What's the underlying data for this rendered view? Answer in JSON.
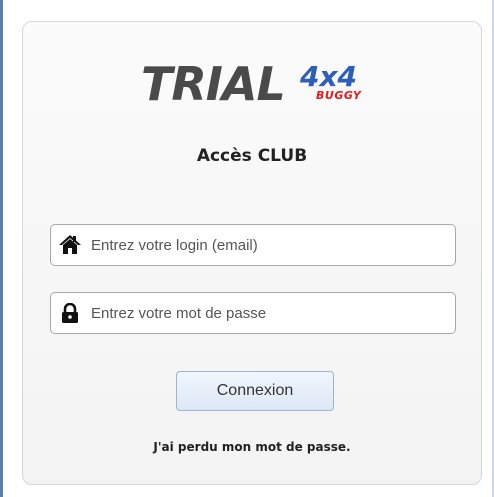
{
  "logo": {
    "main": "TRIAL",
    "mark": "4x4",
    "sub": "BUGGY",
    "colors": {
      "main": "#4a4a4a",
      "mark": "#2e5fb8",
      "sub": "#e11b1b"
    }
  },
  "title": "Accès CLUB",
  "login": {
    "icon": "home-icon",
    "placeholder": "Entrez votre login (email)",
    "value": ""
  },
  "password": {
    "icon": "lock-icon",
    "placeholder": "Entrez votre mot de passe",
    "value": ""
  },
  "connect_label": "Connexion",
  "lost_password": "J'ai perdu mon mot de passe."
}
